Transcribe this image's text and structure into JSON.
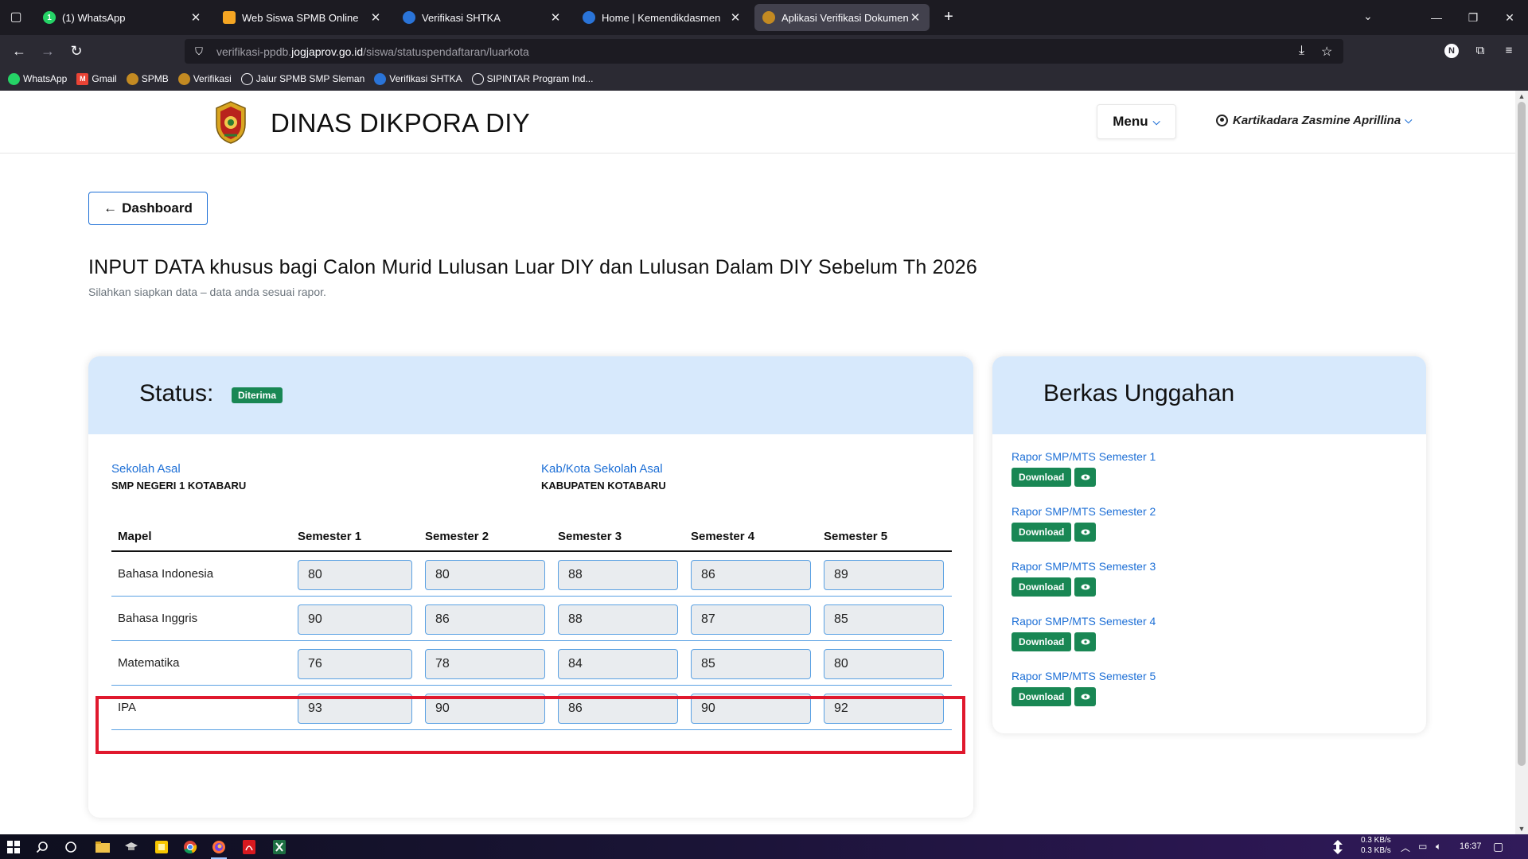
{
  "browser": {
    "tabs": [
      {
        "title": "(1) WhatsApp",
        "badge": "1",
        "active": false
      },
      {
        "title": "Web Siswa SPMB Online",
        "active": false
      },
      {
        "title": "Verifikasi SHTKA",
        "active": false
      },
      {
        "title": "Home | Kemendikdasmen",
        "active": false
      },
      {
        "title": "Aplikasi Verifikasi Dokumen da",
        "active": true
      }
    ],
    "url_prefix": "verifikasi-ppdb.",
    "url_host": "jogjaprov.go.id",
    "url_path": "/siswa/statuspendaftaran/luarkota",
    "extension_letter": "N",
    "bookmarks": [
      "WhatsApp",
      "Gmail",
      "SPMB",
      "Verifikasi",
      "Jalur SPMB SMP Sleman",
      "Verifikasi SHTKA",
      "SIPINTAR Program Ind..."
    ]
  },
  "header": {
    "brand": "DINAS DIKPORA DIY",
    "menu_label": "Menu",
    "user_name": "Kartikadara Zasmine Aprillina"
  },
  "main": {
    "dashboard_label": "Dashboard",
    "title": "INPUT DATA khusus bagi Calon Murid Lulusan Luar DIY dan Lulusan Dalam DIY Sebelum Th 2026",
    "subtitle": "Silahkan siapkan data – data anda sesuai rapor."
  },
  "status_card": {
    "label": "Status:",
    "badge": "Diterima",
    "school_label": "Sekolah Asal",
    "school_value": "SMP NEGERI 1 KOTABARU",
    "city_label": "Kab/Kota Sekolah Asal",
    "city_value": "KABUPATEN KOTABARU",
    "columns": [
      "Mapel",
      "Semester 1",
      "Semester 2",
      "Semester 3",
      "Semester 4",
      "Semester 5"
    ],
    "rows": [
      {
        "mapel": "Bahasa Indonesia",
        "grades": [
          "80",
          "80",
          "88",
          "86",
          "89"
        ]
      },
      {
        "mapel": "Bahasa Inggris",
        "grades": [
          "90",
          "86",
          "88",
          "87",
          "85"
        ]
      },
      {
        "mapel": "Matematika",
        "grades": [
          "76",
          "78",
          "84",
          "85",
          "80"
        ]
      },
      {
        "mapel": "IPA",
        "grades": [
          "93",
          "90",
          "86",
          "90",
          "92"
        ]
      }
    ]
  },
  "berkas_card": {
    "title": "Berkas Unggahan",
    "download_label": "Download",
    "items": [
      "Rapor SMP/MTS Semester 1",
      "Rapor SMP/MTS Semester 2",
      "Rapor SMP/MTS Semester 3",
      "Rapor SMP/MTS Semester 4",
      "Rapor SMP/MTS Semester 5"
    ]
  },
  "taskbar": {
    "net_up": "0.3 KB/s",
    "net_down": "0.3 KB/s",
    "time": "16:37"
  },
  "colors": {
    "accent": "#1d6fd6",
    "success": "#198754",
    "card_header": "#d7e9fc",
    "highlight": "#e0182d"
  }
}
